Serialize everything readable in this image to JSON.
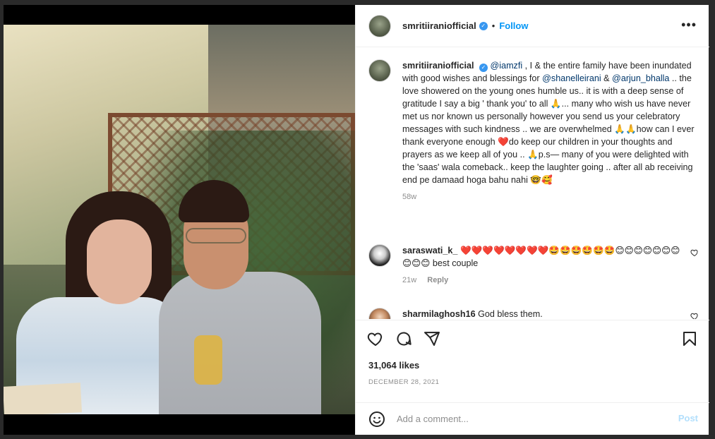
{
  "header": {
    "username": "smritiiraniofficial",
    "separator": "•",
    "follow_label": "Follow",
    "more_label": "•••"
  },
  "caption": {
    "username": "smritiiraniofficial",
    "mention1": "@iamzfi",
    "text1": " , I & the entire family have been inundated with good wishes and blessings for ",
    "mention2": "@shanelleirani",
    "text2": " & ",
    "mention3": "@arjun_bhalla",
    "text3": " .. the love showered on the young ones humble us.. it is with a deep sense of gratitude I say a big ' thank you' to all 🙏... many who wish us have never met us nor known us personally however you send us your celebratory messages with such kindness .. we are overwhelmed 🙏🙏how can I ever thank everyone enough ❤️do keep our children in your thoughts and prayers as we keep all of you .. 🙏p.s— many of you were delighted with the 'saas' wala comeback.. keep the laughter going .. after all ab receiving end pe damaad hoga bahu nahi 🤓🥰",
    "age": "58w"
  },
  "comments": [
    {
      "username": "saraswati_k_",
      "text": "❤️❤️❤️❤️❤️❤️❤️❤️🤩🤩🤩🤩🤩🤩😊😊😊😊😊😊😊😊😊😊 best couple",
      "age": "21w",
      "reply_label": "Reply"
    },
    {
      "username": "sharmilaghosh16",
      "text": "God bless them."
    }
  ],
  "post": {
    "likes": "31,064 likes",
    "date": "DECEMBER 28, 2021"
  },
  "add_comment": {
    "placeholder": "Add a comment...",
    "post_label": "Post"
  },
  "icons": {
    "verified": "verified-badge-icon",
    "like": "heart-icon",
    "comment": "comment-icon",
    "share": "share-icon",
    "save": "bookmark-icon",
    "emoji": "emoji-icon"
  },
  "colors": {
    "accent": "#0095f6",
    "verified": "#3897f0",
    "mention": "#00376b",
    "muted": "#8e8e8e",
    "post_disabled": "#b2dffc"
  }
}
